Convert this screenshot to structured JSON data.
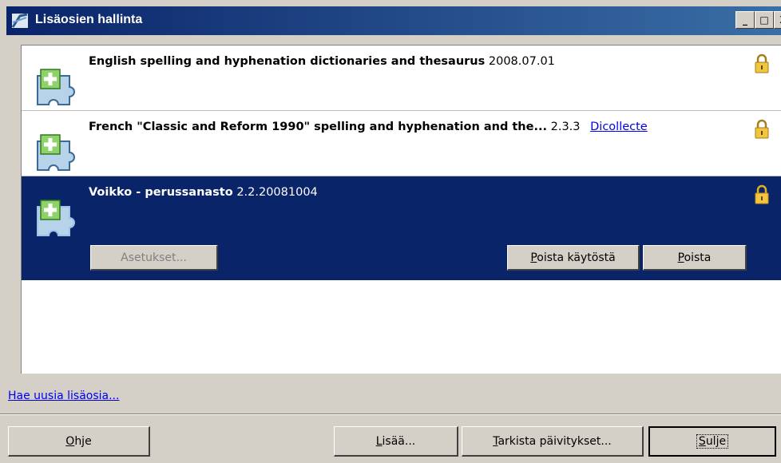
{
  "window": {
    "title": "Lisäosien hallinta",
    "controls": {
      "minimize": "_",
      "maximize": "□",
      "close": "X"
    }
  },
  "extensions": [
    {
      "name": "English spelling and hyphenation dictionaries and thesaurus",
      "version": "2008.07.01",
      "link": "",
      "selected": false,
      "icon": "puzzle-icon",
      "lock_icon": "lock-icon"
    },
    {
      "name": "French \"Classic and Reform 1990\" spelling and hyphenation and the...",
      "version": "2.3.3",
      "link": "Dicollecte",
      "selected": false,
      "icon": "puzzle-icon",
      "lock_icon": "lock-icon"
    },
    {
      "name": "Voikko - perussanasto",
      "version": "2.2.20081004",
      "link": "",
      "selected": true,
      "icon": "puzzle-icon",
      "lock_icon": "lock-icon"
    }
  ],
  "selected_actions": {
    "options": "Asetukset...",
    "disable": {
      "access_key": "P",
      "rest": "oista käytöstä"
    },
    "remove": {
      "access_key": "P",
      "rest": "oista"
    }
  },
  "footer": {
    "get_more_link": "Hae uusia lisäosia...",
    "help": {
      "access_key": "O",
      "rest": "hje"
    },
    "add": {
      "access_key": "L",
      "rest": "isää..."
    },
    "check_updates": {
      "access_key": "T",
      "rest": "arkista päivitykset..."
    },
    "close": {
      "access_key": "S",
      "rest": "ulje"
    }
  },
  "colors": {
    "title_gradient_start": "#0a246a",
    "title_gradient_end": "#3a6ea5",
    "selection": "#0a246a",
    "face": "#d4d0c8",
    "link": "#0000ee"
  }
}
